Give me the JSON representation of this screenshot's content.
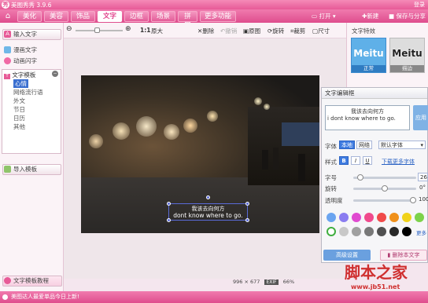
{
  "app": {
    "title": "美图秀秀 3.9.6",
    "login": "登录"
  },
  "tabs": [
    "美化",
    "美容",
    "饰品",
    "文字",
    "边框",
    "场景",
    "拼图",
    "更多功能"
  ],
  "top_right": {
    "open": "打开",
    "new": "新建",
    "save_share": "保存与分享"
  },
  "toolbar": {
    "zoom_ratio": "1:1",
    "fit": "原大",
    "items": [
      "删除",
      "撤销",
      "原图",
      "旋转",
      "裁剪",
      "尺寸"
    ]
  },
  "left": {
    "input_text": "输入文字",
    "comic_text": "漫画文字",
    "animated_text": "动画闪字",
    "templates_title": "文字模板",
    "templates": [
      "心情",
      "网络流行语",
      "外文",
      "节日",
      "日历",
      "其他"
    ],
    "import_template": "导入模板",
    "tutorial": "文字模板教程"
  },
  "caption": {
    "cn": "我该去向何方",
    "en": "dont know where to go."
  },
  "right": {
    "effects_title": "文字特效",
    "effects": [
      {
        "text": "Meitu",
        "label": "正常"
      },
      {
        "text": "Meitu",
        "label": "描边"
      }
    ]
  },
  "edit_dialog": {
    "title": "文字编辑框",
    "text_line1": "我该去向何方",
    "text_line2": "i dont know where to go.",
    "apply": "应用",
    "font_label": "字体",
    "font_local": "本地",
    "font_web": "网络",
    "font_name": "默认字体",
    "style_label": "样式",
    "style_b": "B",
    "style_i": "I",
    "style_u": "U",
    "download_font": "下载更多字体",
    "size_label": "字号",
    "size_value": "26",
    "rotate_label": "旋转",
    "rotate_value": "0°",
    "opacity_label": "透明度",
    "opacity_value": "100",
    "more": "更多",
    "advanced": "高级设置",
    "delete": "删除本文字",
    "swatches": [
      "#6aa4f0",
      "#8a7cf0",
      "#e04ad0",
      "#f04a8c",
      "#f04a4a",
      "#f0901a",
      "#f0d21a",
      "#7cd24a",
      "#ffffff",
      "#c8c8c8",
      "#a0a0a0",
      "#787878",
      "#505050",
      "#282828",
      "#000000"
    ]
  },
  "status": {
    "message": "美图达人最爱单品今日上新!",
    "dimensions": "996 × 677",
    "exif": "EXIF",
    "zoom": "66%"
  },
  "watermark": {
    "brand": "脚本之家",
    "url": "www.jb51.net"
  }
}
